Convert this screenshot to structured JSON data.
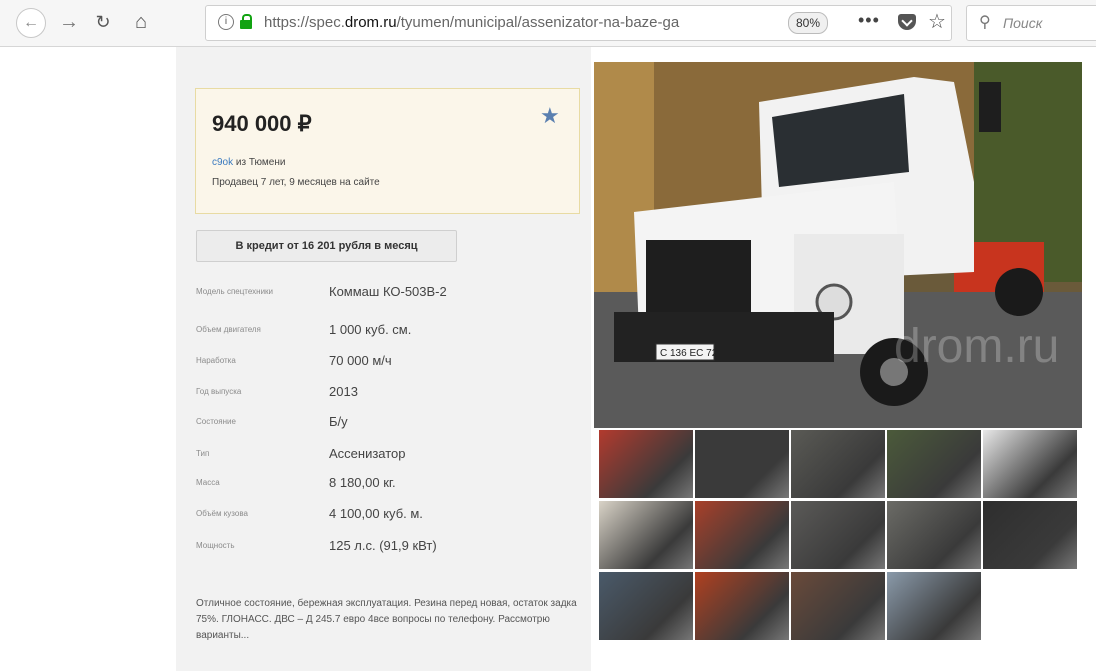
{
  "browser": {
    "url_prefix": "https://spec.",
    "url_domain": "drom.ru",
    "url_path": "/tyumen/municipal/assenizator-na-baze-ga",
    "zoom": "80%",
    "more": "•••",
    "search_placeholder": "Поиск"
  },
  "listing": {
    "price": "940 000 ₽",
    "seller_name": "c9ok",
    "seller_city": "из Тюмени",
    "seller_since": "Продавец 7 лет, 9 месяцев на сайте",
    "credit_button": "В кредит от 16 201 рубля в месяц",
    "specs": [
      {
        "label": "Модель спецтехники",
        "value": "Коммаш КО-503В-2"
      },
      {
        "label": "Объем двигателя",
        "value": "1 000 куб. см."
      },
      {
        "label": "Наработка",
        "value": "70 000 м/ч"
      },
      {
        "label": "Год выпуска",
        "value": "2013"
      },
      {
        "label": "Состояние",
        "value": "Б/у"
      },
      {
        "label": "Тип",
        "value": "Ассенизатор"
      },
      {
        "label": "Масса",
        "value": "8 180,00 кг."
      },
      {
        "label": "Объём кузова",
        "value": "4 100,00 куб. м."
      },
      {
        "label": "Мощность",
        "value": "125 л.с. (91,9 кВт)"
      }
    ],
    "description": "Отличное состояние, бережная эксплуатация. Резина перед новая, остаток задка 75%. ГЛОНАСС. ДВС – Д 245.7 евро 4все вопросы по телефону. Рассмотрю варианты..."
  },
  "photos": {
    "watermark": "drom.ru",
    "plate": "С 136 ЕС 72",
    "thumb_colors": [
      "#b23a2e",
      "#3a3a3a",
      "#5a5a55",
      "#4b5a3a",
      "#e8e8e8",
      "#d9d3c7",
      "#a8402a",
      "#5b5a58",
      "#6b6b66",
      "#2e2e2e",
      "#4a5a6a",
      "#b04020",
      "#6a4a3a",
      "#8a9aaa"
    ]
  }
}
